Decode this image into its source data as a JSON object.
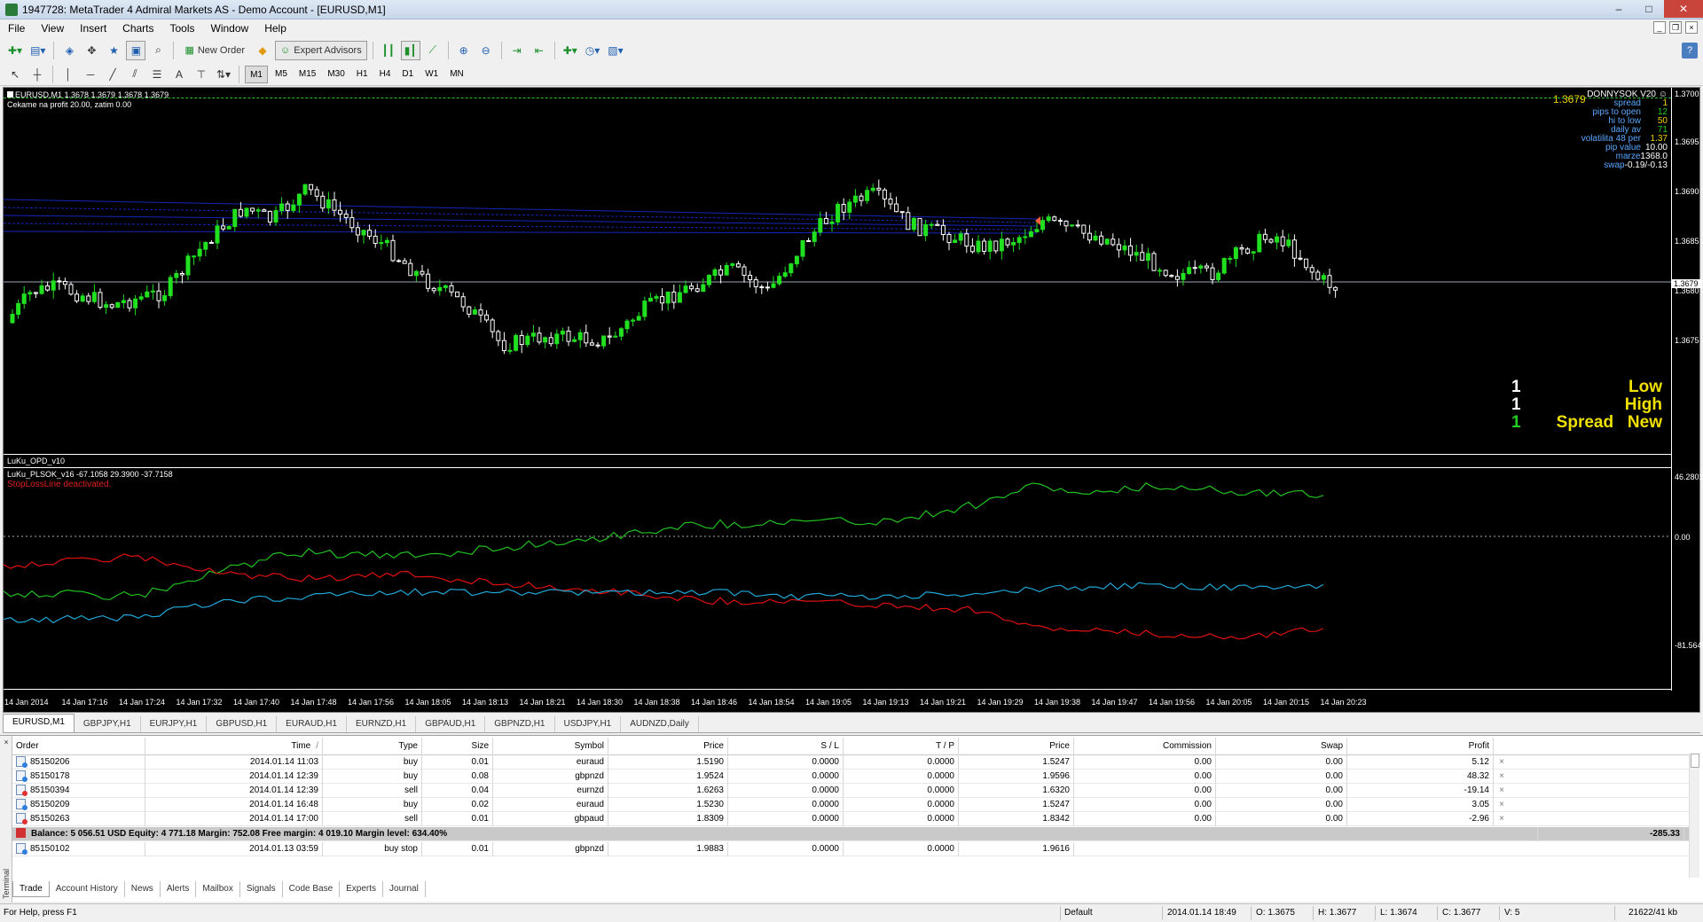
{
  "window": {
    "title": "1947728: MetaTrader 4 Admiral Markets AS - Demo Account - [EURUSD,M1]",
    "minimize": "–",
    "maximize": "□",
    "close": "✕"
  },
  "menu": [
    "File",
    "View",
    "Insert",
    "Charts",
    "Tools",
    "Window",
    "Help"
  ],
  "toolbar": {
    "new_order_label": "New Order",
    "expert_advisors_label": "Expert Advisors",
    "timeframes": [
      "M1",
      "M5",
      "M15",
      "M30",
      "H1",
      "H4",
      "D1",
      "W1",
      "MN"
    ],
    "active_timeframe": "M1"
  },
  "chart": {
    "info_line": "EURUSD,M1  1.3678 1.3679 1.3678 1.3679",
    "info_line2": "Cekame na profit 20.00, zatim 0.00",
    "current_price_label": "1.3679",
    "indicator_panel": {
      "header": "DONNYSOK V20",
      "rows": [
        {
          "key": "spread",
          "value": "1",
          "color": "#f0d000"
        },
        {
          "key": "pips to open",
          "value": "12",
          "color": "#20d020"
        },
        {
          "key": "hi to low",
          "value": "50",
          "color": "#f0d000"
        },
        {
          "key": "daily av",
          "value": "71",
          "color": "#20d020"
        },
        {
          "key": "volatilita 48 per",
          "value": "1.37",
          "color": "#f0d000"
        },
        {
          "key": "pip value",
          "value": "10.00",
          "color": "#ffffff"
        },
        {
          "key": "marze",
          "value": "1368.0",
          "color": "#ffffff"
        },
        {
          "key": "swap",
          "value": "-0.19/-0.13",
          "color": "#ffffff"
        }
      ]
    },
    "big_panel": [
      {
        "num": "1",
        "label": "Low",
        "num_color": "#ffffff",
        "label_color": "#f0e000"
      },
      {
        "num": "1",
        "label": "High",
        "num_color": "#ffffff",
        "label_color": "#f0e000"
      },
      {
        "num": "1",
        "label": "Spread   New",
        "num_color": "#20d020",
        "label_color": "#f0e000"
      }
    ],
    "opd_label": "LuKu_OPD_v10",
    "sub_info": "LuKu_PLSOK_v16 -67.1058 29.3900 -37.7158",
    "sub_warning": "StopLossLine deactivated.",
    "price_ticks": [
      "1.3700",
      "1.3695",
      "1.3690",
      "1.3685",
      "1.3680",
      "1.3675"
    ],
    "price_current": "1.3679",
    "sub_ticks": [
      "46.2801",
      "0.00",
      "-81.5649"
    ],
    "time_ticks": [
      "14 Jan 2014",
      "14 Jan 17:16",
      "14 Jan 17:24",
      "14 Jan 17:32",
      "14 Jan 17:40",
      "14 Jan 17:48",
      "14 Jan 17:56",
      "14 Jan 18:05",
      "14 Jan 18:13",
      "14 Jan 18:21",
      "14 Jan 18:30",
      "14 Jan 18:38",
      "14 Jan 18:46",
      "14 Jan 18:54",
      "14 Jan 19:05",
      "14 Jan 19:13",
      "14 Jan 19:21",
      "14 Jan 19:29",
      "14 Jan 19:38",
      "14 Jan 19:47",
      "14 Jan 19:56",
      "14 Jan 20:05",
      "14 Jan 20:15",
      "14 Jan 20:23"
    ],
    "colors": {
      "bull": "#20e020",
      "bear": "#ffffff",
      "line_green": "#20c020",
      "line_red": "#e01010",
      "line_cyan": "#20a8d8",
      "blue_lines": "#1a2ad0"
    }
  },
  "symbol_tabs": [
    "EURUSD,M1",
    "GBPJPY,H1",
    "EURJPY,H1",
    "GBPUSD,H1",
    "EURAUD,H1",
    "EURNZD,H1",
    "GBPAUD,H1",
    "GBPNZD,H1",
    "USDJPY,H1",
    "AUDNZD,Daily"
  ],
  "active_symbol_tab": "EURUSD,M1",
  "terminal": {
    "side_label": "Terminal",
    "columns": [
      "Order",
      "Time",
      "Type",
      "Size",
      "Symbol",
      "Price",
      "S / L",
      "T / P",
      "Price",
      "Commission",
      "Swap",
      "Profit"
    ],
    "sort_marker": "/",
    "orders": [
      {
        "order": "85150206",
        "time": "2014.01.14 11:03",
        "type": "buy",
        "size": "0.01",
        "symbol": "euraud",
        "price": "1.5190",
        "sl": "0.0000",
        "tp": "0.0000",
        "price2": "1.5247",
        "commission": "0.00",
        "swap": "0.00",
        "profit": "5.12"
      },
      {
        "order": "85150178",
        "time": "2014.01.14 12:39",
        "type": "buy",
        "size": "0.08",
        "symbol": "gbpnzd",
        "price": "1.9524",
        "sl": "0.0000",
        "tp": "0.0000",
        "price2": "1.9596",
        "commission": "0.00",
        "swap": "0.00",
        "profit": "48.32"
      },
      {
        "order": "85150394",
        "time": "2014.01.14 12:39",
        "type": "sell",
        "size": "0.04",
        "symbol": "eurnzd",
        "price": "1.6263",
        "sl": "0.0000",
        "tp": "0.0000",
        "price2": "1.6320",
        "commission": "0.00",
        "swap": "0.00",
        "profit": "-19.14"
      },
      {
        "order": "85150209",
        "time": "2014.01.14 16:48",
        "type": "buy",
        "size": "0.02",
        "symbol": "euraud",
        "price": "1.5230",
        "sl": "0.0000",
        "tp": "0.0000",
        "price2": "1.5247",
        "commission": "0.00",
        "swap": "0.00",
        "profit": "3.05"
      },
      {
        "order": "85150263",
        "time": "2014.01.14 17:00",
        "type": "sell",
        "size": "0.01",
        "symbol": "gbpaud",
        "price": "1.8309",
        "sl": "0.0000",
        "tp": "0.0000",
        "price2": "1.8342",
        "commission": "0.00",
        "swap": "0.00",
        "profit": "-2.96"
      }
    ],
    "balance_line": "Balance: 5 056.51 USD  Equity: 4 771.18  Margin: 752.08  Free margin: 4 019.10  Margin level: 634.40%",
    "balance_profit": "-285.33",
    "pending": {
      "order": "85150102",
      "time": "2014.01.13 03:59",
      "type": "buy stop",
      "size": "0.01",
      "symbol": "gbpnzd",
      "price": "1.9883",
      "sl": "0.0000",
      "tp": "0.0000",
      "price2": "1.9616"
    },
    "tabs": [
      "Trade",
      "Account History",
      "News",
      "Alerts",
      "Mailbox",
      "Signals",
      "Code Base",
      "Experts",
      "Journal"
    ],
    "active_tab": "Trade"
  },
  "status": {
    "help": "For Help, press F1",
    "profile": "Default",
    "time": "2014.01.14 18:49",
    "o": "O: 1.3675",
    "h": "H: 1.3677",
    "l": "L: 1.3674",
    "c": "C: 1.3677",
    "v": "V: 5",
    "traffic": "21622/41 kb"
  }
}
